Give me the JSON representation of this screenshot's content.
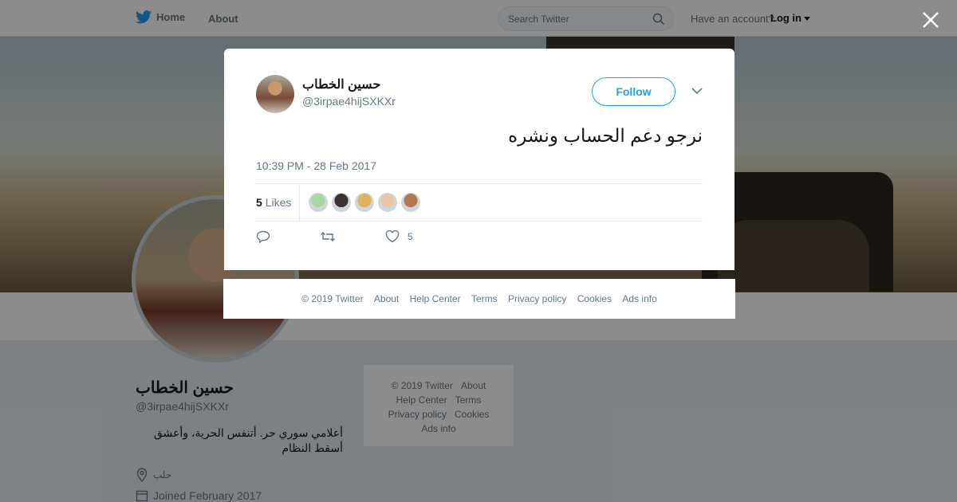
{
  "nav": {
    "home_label": "Home",
    "about_label": "About",
    "search_placeholder": "Search Twitter",
    "have_account": "Have an account?",
    "login_label": "Log in"
  },
  "profile": {
    "name": "حسين الخطاب",
    "handle": "@3irpae4hijSXKXr",
    "bio": "أعلامي سوري حر. أتنفس الحرية، وأعشق أسقط النظام",
    "location": "حلب",
    "joined": "Joined February 2017"
  },
  "side_footer": {
    "copyright": "© 2019 Twitter",
    "about": "About",
    "help": "Help Center",
    "terms": "Terms",
    "privacy": "Privacy policy",
    "cookies": "Cookies",
    "ads": "Ads info"
  },
  "tweet": {
    "author_name": "حسين الخطاب",
    "author_handle": "@3irpae4hijSXKXr",
    "follow_label": "Follow",
    "text": "نرجو دعم الحساب ونشره",
    "timestamp": "10:39 PM - 28 Feb 2017",
    "likes_count": "5",
    "likes_label": "Likes",
    "like_action_count": "5",
    "liker_colors": [
      "#a9d7a4",
      "#3b3230",
      "#e0b35a",
      "#e8c6a6",
      "#b07a4e"
    ]
  },
  "modal_footer": {
    "copyright": "© 2019 Twitter",
    "about": "About",
    "help": "Help Center",
    "terms": "Terms",
    "privacy": "Privacy policy",
    "cookies": "Cookies",
    "ads": "Ads info"
  },
  "colors": {
    "accent": "#1da1f2",
    "text_secondary": "#657786"
  }
}
